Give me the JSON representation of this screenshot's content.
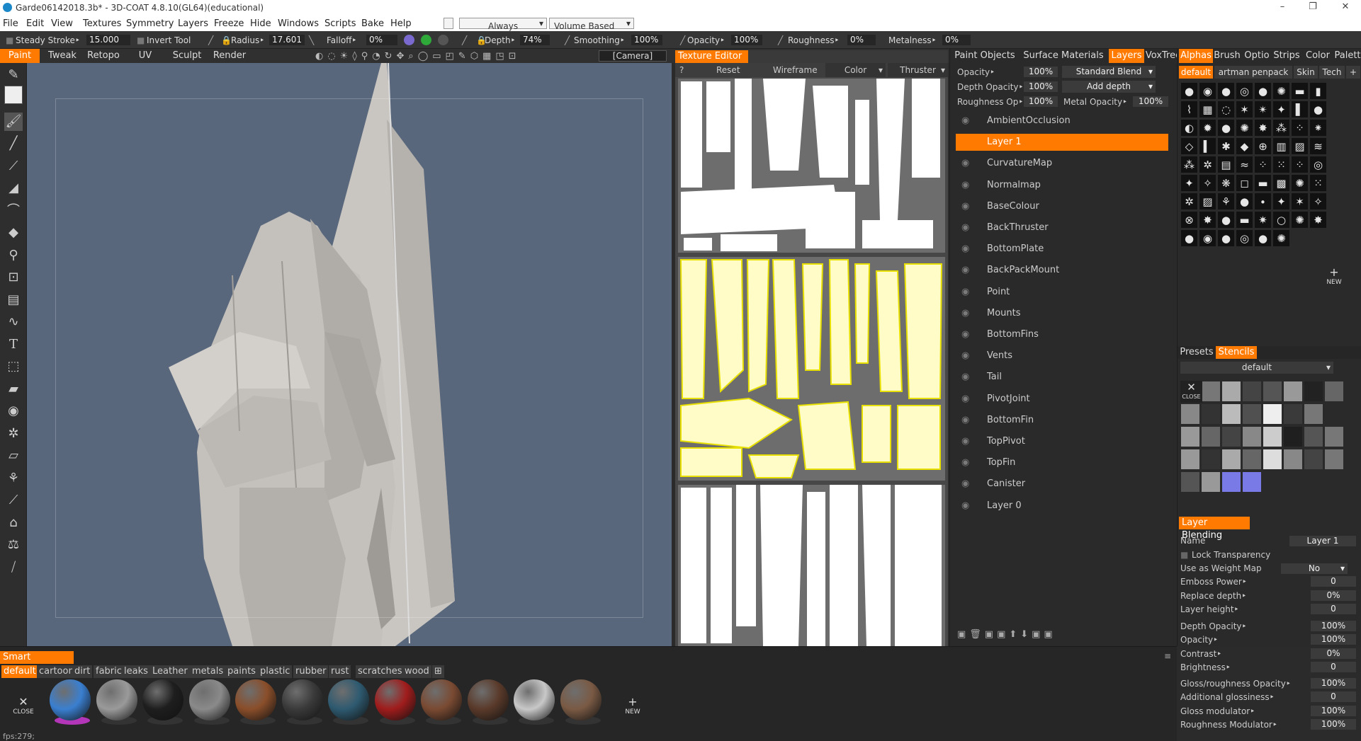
{
  "window": {
    "title": "Garde06142018.3b* - 3D-COAT 4.8.10(GL64)(educational)",
    "min": "–",
    "max": "❐",
    "close": "✕"
  },
  "menu": [
    "File",
    "Edit",
    "View",
    "Textures",
    "Symmetry",
    "Layers",
    "Freeze",
    "Hide",
    "Windows",
    "Scripts",
    "Bake",
    "Help"
  ],
  "menu_controls": {
    "always": "Always",
    "volume": "Volume Based"
  },
  "toolbar": {
    "steady_stroke": "Steady  Stroke‣",
    "steady_value": "15.000",
    "invert_tool": "Invert  Tool",
    "radius": "Radius‣",
    "radius_value": "17.601",
    "falloff": "Falloff‣",
    "falloff_value": "0%",
    "depth": "Depth‣",
    "depth_value": "74%",
    "smoothing": "Smoothing‣",
    "smoothing_value": "100%",
    "opacity": "Opacity‣",
    "opacity_value": "100%",
    "roughness": "Roughness‣",
    "roughness_value": "0%",
    "metalness": "Metalness‣",
    "metalness_value": "0%"
  },
  "rooms": [
    "Paint",
    "Tweak",
    "Retopo",
    "UV",
    "Sculpt",
    "Render"
  ],
  "camera_label": "[Camera]",
  "texture_editor": {
    "title": "Texture  Editor",
    "help": "?",
    "buttons": [
      "Reset",
      "Wireframe",
      "Color",
      "Thruster"
    ]
  },
  "layers_tabs": [
    "Paint  Objects",
    "Surface  Materials",
    "Layers",
    "VoxTree"
  ],
  "layer_props": [
    {
      "label": "Opacity‣",
      "value": "100%",
      "mode": "Standard  Blend"
    },
    {
      "label": "Depth  Opacity‣",
      "value": "100%",
      "mode": "Add  depth"
    },
    {
      "label": "Roughness  Op‣",
      "value": "100%",
      "mode": "Metal  Opacity‣",
      "mode_value": "100%"
    }
  ],
  "layers": [
    "AmbientOcclusion",
    "Layer  1",
    "CurvatureMap",
    "Normalmap",
    "BaseColour",
    "BackThruster",
    "BottomPlate",
    "BackPackMount",
    "Point",
    "Mounts",
    "BottomFins",
    "Vents",
    "Tail",
    "PivotJoint",
    "BottomFin",
    "TopPivot",
    "TopFin",
    "Canister",
    "Layer  0"
  ],
  "selected_layer_index": 1,
  "alpha_tabs": [
    "Alphas",
    "Brush",
    "Optio",
    "Strips",
    "Color",
    "Palett"
  ],
  "alpha_sets": [
    "default",
    "artman  penpack",
    "Skin",
    "Tech"
  ],
  "alpha_new": "NEW",
  "stencil_tabs": [
    "Presets",
    "Stencils"
  ],
  "stencil_set": "default",
  "stencil_close": "CLOSE",
  "layer_blending": {
    "title": "Layer  Blending",
    "name_label": "Name",
    "name_value": "Layer  1",
    "lock_transparency": "Lock  Transparency",
    "weight_map": "Use  as  Weight  Map",
    "weight_value": "No",
    "params": [
      {
        "label": "Emboss  Power‣",
        "value": "0"
      },
      {
        "label": "Replace  depth‣",
        "value": "0%"
      },
      {
        "label": "Layer  height‣",
        "value": "0"
      },
      {
        "label": "Depth  Opacity‣",
        "value": "100%"
      },
      {
        "label": "Opacity‣",
        "value": "100%"
      },
      {
        "label": "Contrast‣",
        "value": "0%"
      },
      {
        "label": "Brightness‣",
        "value": "0"
      },
      {
        "label": "Gloss/roughness  Opacity‣",
        "value": "100%"
      },
      {
        "label": "Additional  glossiness‣",
        "value": "0"
      },
      {
        "label": "Gloss  modulator‣",
        "value": "100%"
      },
      {
        "label": "Roughness  Modulator‣",
        "value": "100%"
      }
    ]
  },
  "smart_materials": {
    "title": "Smart  Materials",
    "tabs": [
      "default",
      "cartoon",
      "dirt",
      "fabric",
      "leaks",
      "Leather",
      "metals",
      "paints",
      "plastic",
      "rubber",
      "rust",
      "scratches",
      "wood"
    ],
    "close": "CLOSE",
    "new": "NEW",
    "colors": [
      "#3a7fd0",
      "#9a9a9a",
      "#1e1e1e",
      "#8a8a8a",
      "#8a4e2a",
      "#3a3a3a",
      "#2e5a70",
      "#a01c1c",
      "#7a4a32",
      "#5a3a2a",
      "#c8c8c8",
      "#7a5a44"
    ]
  },
  "status": "fps:279;"
}
